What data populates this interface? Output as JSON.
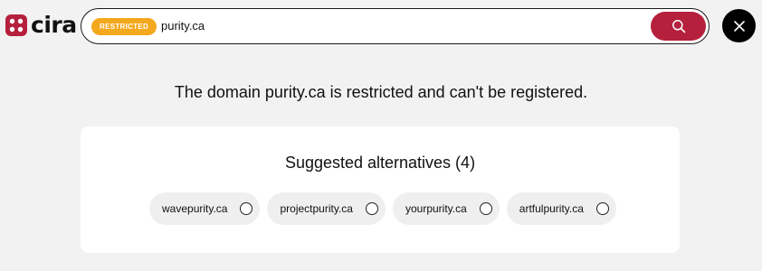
{
  "header": {
    "logo_text": "cira",
    "search": {
      "status_badge": "RESTRICTED",
      "value": "purity.ca",
      "button_icon": "search-icon"
    },
    "close_icon": "close-icon"
  },
  "message": "The domain purity.ca is restricted and can't be registered.",
  "suggestions": {
    "title": "Suggested alternatives (4)",
    "items": [
      {
        "label": "wavepurity.ca",
        "selected": false
      },
      {
        "label": "projectpurity.ca",
        "selected": false
      },
      {
        "label": "yourpurity.ca",
        "selected": false
      },
      {
        "label": "artfulpurity.ca",
        "selected": false
      }
    ]
  },
  "colors": {
    "brand_red": "#b5203d",
    "badge_orange": "#f4a81d",
    "background": "#f2f2f2",
    "close_button": "#000000"
  }
}
